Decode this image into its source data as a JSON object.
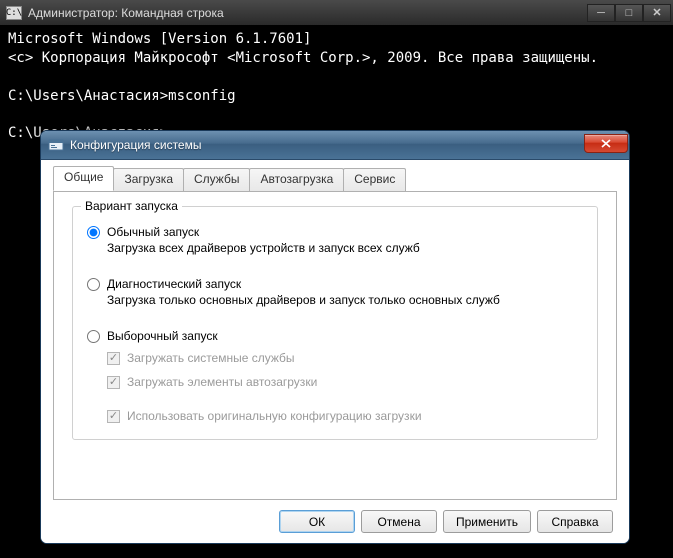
{
  "console": {
    "title": "Администратор: Командная строка",
    "icon_text": "C:\\",
    "lines": [
      "Microsoft Windows [Version 6.1.7601]",
      "<c> Корпорация Майкрософт <Microsoft Corp.>, 2009. Все права защищены.",
      "",
      "C:\\Users\\Анастасия>msconfig",
      "",
      "C:\\Users\\Анастасия>"
    ]
  },
  "dialog": {
    "title": "Конфигурация системы",
    "tabs": [
      "Общие",
      "Загрузка",
      "Службы",
      "Автозагрузка",
      "Сервис"
    ],
    "fieldset_legend": "Вариант запуска",
    "options": {
      "normal": {
        "label": "Обычный запуск",
        "desc": "Загрузка всех драйверов устройств и запуск всех служб"
      },
      "diag": {
        "label": "Диагностический запуск",
        "desc": "Загрузка только основных драйверов и запуск только основных служб"
      },
      "selective": {
        "label": "Выборочный запуск"
      }
    },
    "checks": {
      "sys_services": "Загружать системные службы",
      "autostart": "Загружать элементы автозагрузки",
      "orig_boot": "Использовать оригинальную конфигурацию загрузки"
    },
    "buttons": {
      "ok": "ОК",
      "cancel": "Отмена",
      "apply": "Применить",
      "help": "Справка"
    }
  }
}
